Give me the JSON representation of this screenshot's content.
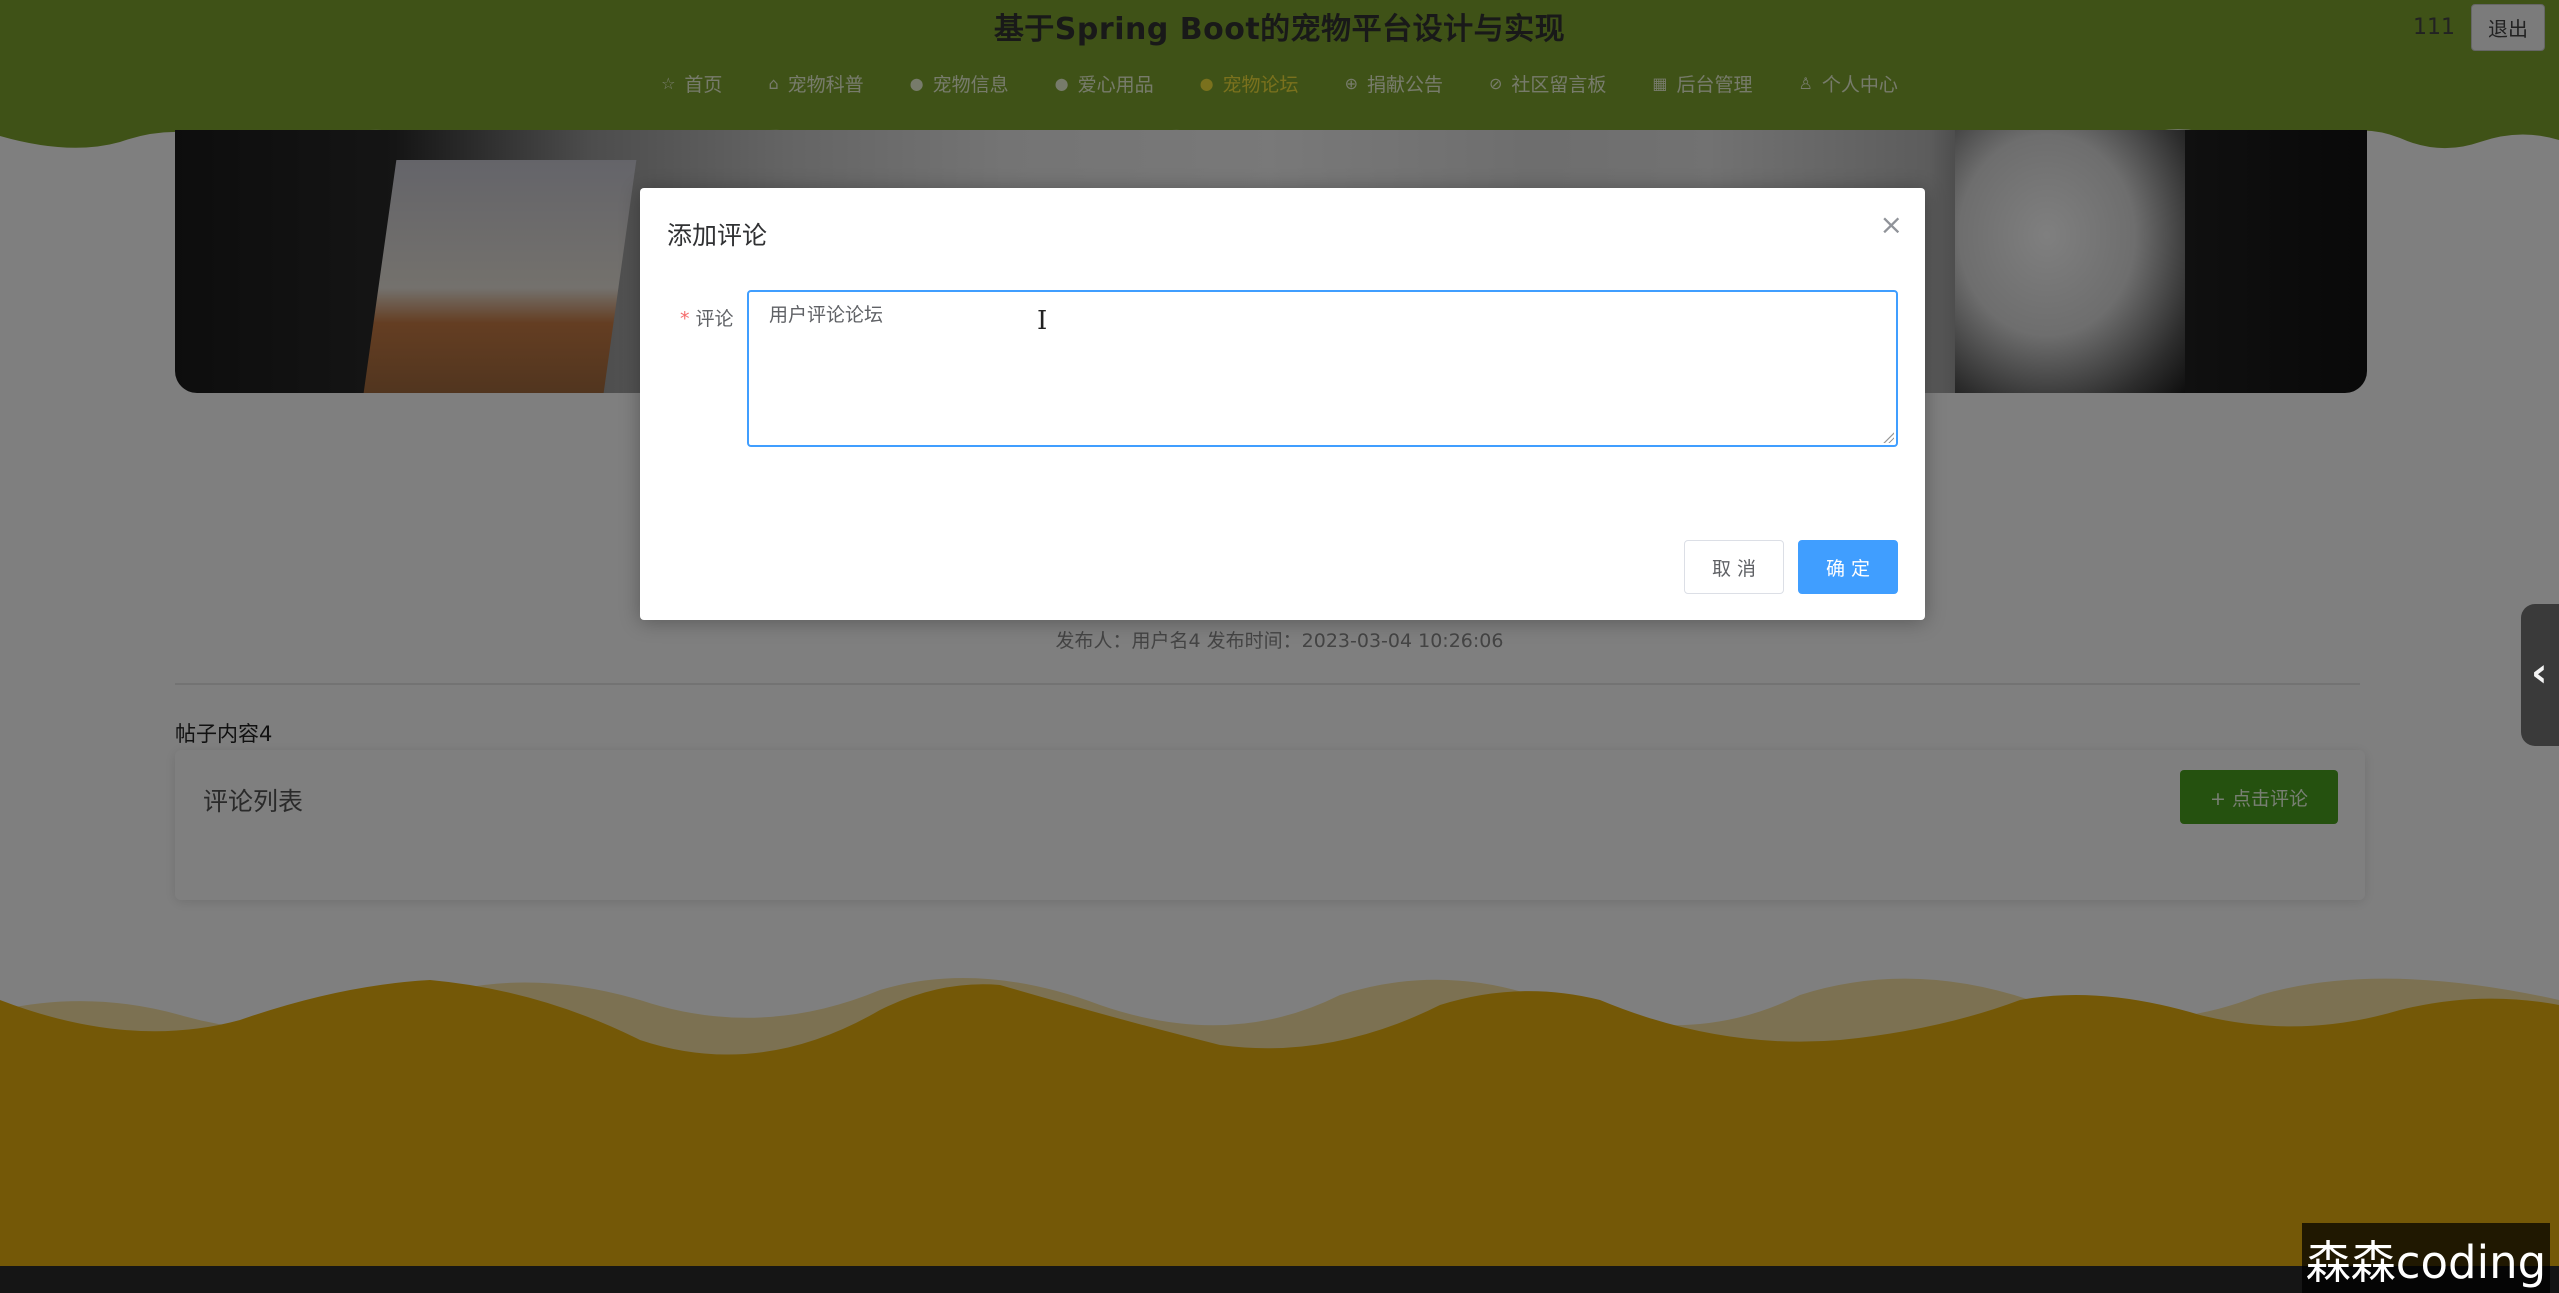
{
  "header": {
    "title": "基于Spring Boot的宠物平台设计与实现",
    "user": "111",
    "logout": "退出",
    "nav": [
      {
        "label": "首页",
        "icon": "star-icon",
        "active": false
      },
      {
        "label": "宠物科普",
        "icon": "lock-icon",
        "active": false
      },
      {
        "label": "宠物信息",
        "icon": "dot-icon",
        "active": false
      },
      {
        "label": "爱心用品",
        "icon": "dot-icon",
        "active": false
      },
      {
        "label": "宠物论坛",
        "icon": "dot-icon",
        "active": true
      },
      {
        "label": "捐献公告",
        "icon": "circle-icon",
        "active": false
      },
      {
        "label": "社区留言板",
        "icon": "circle-icon",
        "active": false
      },
      {
        "label": "后台管理",
        "icon": "building-icon",
        "active": false
      },
      {
        "label": "个人中心",
        "icon": "user-icon",
        "active": false
      }
    ]
  },
  "post": {
    "meta": "发布人：用户名4  发布时间：2023-03-04 10:26:06",
    "content": "帖子内容4"
  },
  "comments": {
    "title": "评论列表",
    "add_button": "+ 点击评论"
  },
  "dialog": {
    "title": "添加评论",
    "close": "×",
    "field_label": "评论",
    "required_mark": "*",
    "field_value": "用户评论论坛",
    "cancel": "取 消",
    "confirm": "确 定"
  },
  "side_tab": {
    "icon": "chevron-left-icon",
    "glyph": "‹"
  },
  "watermark": "森森coding",
  "colors": {
    "header_green": "#7ea52e",
    "nav_active": "#f4e23a",
    "wave_gold": "#e8b10f",
    "primary": "#409eff",
    "success": "#4aa31e"
  }
}
